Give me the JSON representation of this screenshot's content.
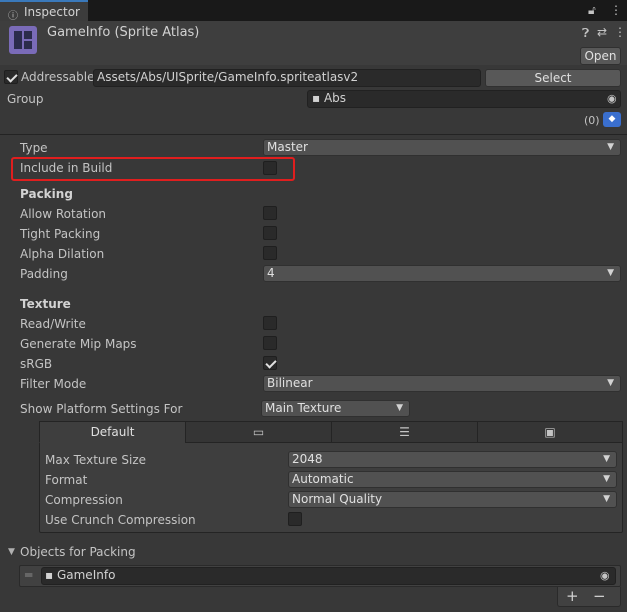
{
  "window": {
    "tab_label": "Inspector",
    "tab_icon": "info-icon"
  },
  "asset": {
    "title": "GameInfo (Sprite Atlas)",
    "open_label": "Open"
  },
  "addressable": {
    "checked": true,
    "label": "Addressable",
    "path": "Assets/Abs/UISprite/GameInfo.spriteatlasv2",
    "select_label": "Select",
    "group_label": "Group",
    "group_value": "Abs",
    "labels_count": "(0)"
  },
  "fields": {
    "type_label": "Type",
    "type_value": "Master",
    "include_label": "Include in Build",
    "include_checked": false
  },
  "packing": {
    "header": "Packing",
    "allow_rotation_label": "Allow Rotation",
    "allow_rotation": false,
    "tight_packing_label": "Tight Packing",
    "tight_packing": false,
    "alpha_dilation_label": "Alpha Dilation",
    "alpha_dilation": false,
    "padding_label": "Padding",
    "padding_value": "4"
  },
  "texture": {
    "header": "Texture",
    "read_write_label": "Read/Write",
    "read_write": false,
    "mipmaps_label": "Generate Mip Maps",
    "mipmaps": false,
    "srgb_label": "sRGB",
    "srgb": true,
    "filter_label": "Filter Mode",
    "filter_value": "Bilinear",
    "platform_label": "Show Platform Settings For",
    "platform_value": "Main Texture"
  },
  "platform_tabs": {
    "default_label": "Default",
    "tab2_icon": "monitor-icon",
    "tab3_icon": "server-icon",
    "tab4_icon": "web-icon"
  },
  "platform": {
    "max_size_label": "Max Texture Size",
    "max_size_value": "2048",
    "format_label": "Format",
    "format_value": "Automatic",
    "compression_label": "Compression",
    "compression_value": "Normal Quality",
    "crunch_label": "Use Crunch Compression",
    "crunch": false
  },
  "objects": {
    "header": "Objects for Packing",
    "items": [
      "GameInfo"
    ]
  },
  "colors": {
    "accent": "#3a79bb",
    "highlight": "#e01e1e",
    "asset_icon": "#7a6bb8",
    "tag_badge": "#3a6fcf"
  }
}
